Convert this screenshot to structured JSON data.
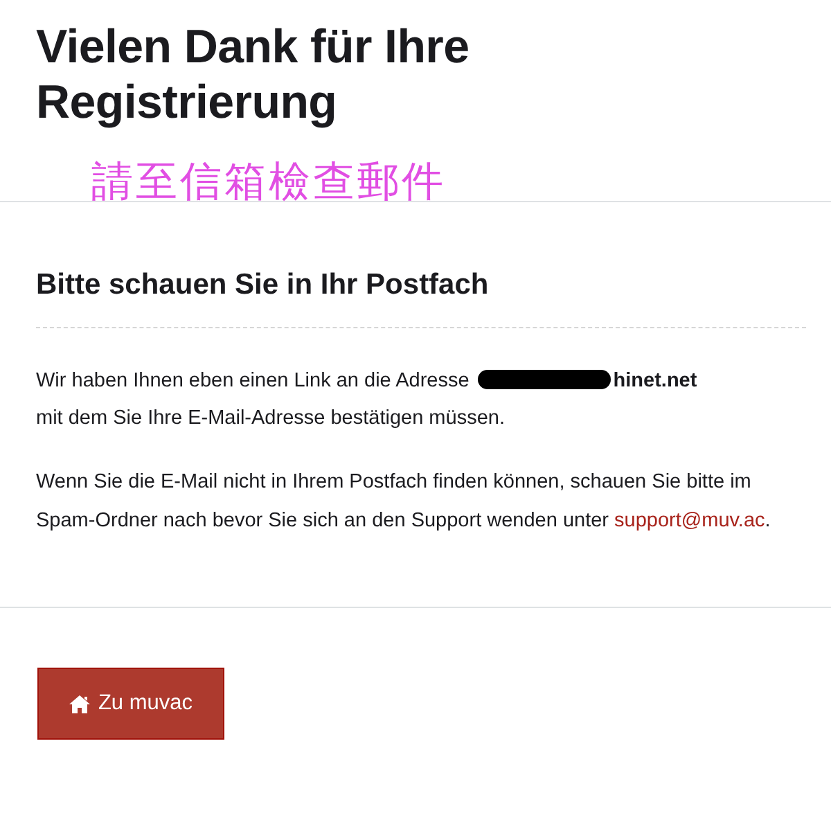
{
  "page": {
    "title": "Vielen Dank für Ihre Registrierung"
  },
  "annotation": {
    "text": "請至信箱檢查郵件"
  },
  "section": {
    "heading": "Bitte schauen Sie in Ihr Postfach",
    "paragraph_1": {
      "before": "Wir haben Ihnen eben einen Link an die Adresse",
      "email_visible": "hinet.net",
      "after": "mit dem Sie Ihre E-Mail-Adresse bestätigen müssen."
    },
    "paragraph_2": {
      "text": "Wenn Sie die E-Mail nicht in Ihrem Postfach finden können, schauen Sie bitte im Spam-Ordner nach bevor Sie sich an den Support wenden unter",
      "link": "support@muv.ac",
      "end": "."
    }
  },
  "button": {
    "label": "Zu muvac"
  }
}
